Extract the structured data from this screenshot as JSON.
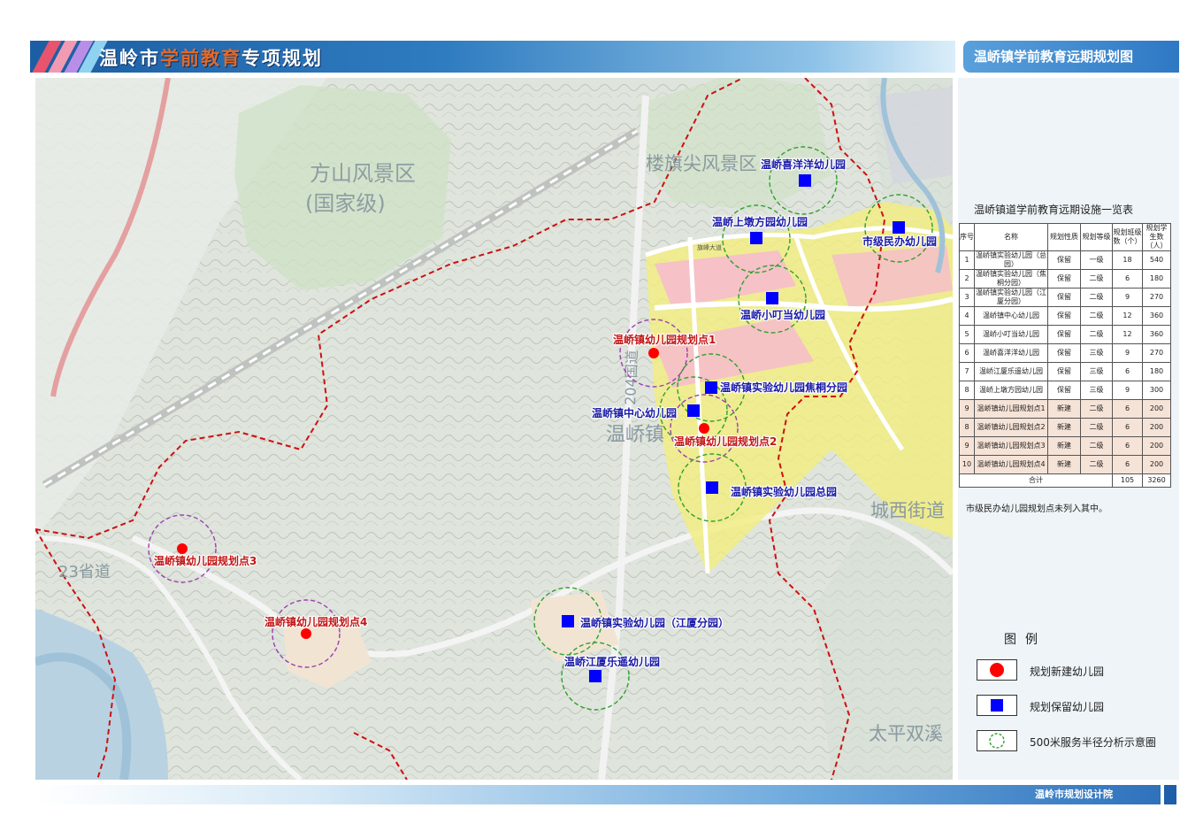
{
  "header": {
    "title_prefix": "温岭市",
    "title_highlight": "学前教育",
    "title_suffix": "专项规划",
    "map_title": "温峤镇学前教育远期规划图"
  },
  "map": {
    "place_labels": {
      "fangshan": "方山风景区",
      "fangshan_level": "(国家级)",
      "louqijian": "楼旗尖风景区",
      "wenqiao": "温峤镇",
      "chengxi": "城西街道",
      "taiping": "太平双溪",
      "road23": "23省道",
      "road204": "204国道",
      "street_east": "旗峰大道"
    },
    "sites": {
      "xiyangyang": "温峤喜洋洋幼儿园",
      "shangdun": "温峤上墩方园幼儿园",
      "shijimin": "市级民办幼儿园",
      "xiaodingdang": "温峤小叮当幼儿园",
      "plan1": "温峤镇幼儿园规划点1",
      "jiaotong": "温峤镇实验幼儿园焦桐分园",
      "zhongxin": "温峤镇中心幼儿园",
      "plan2": "温峤镇幼儿园规划点2",
      "zongyuan": "温峤镇实验幼儿园总园",
      "plan3": "温峤镇幼儿园规划点3",
      "plan4": "温峤镇幼儿园规划点4",
      "jiangxia_branch": "温峤镇实验幼儿园（江厦分园）",
      "jiangxia_leyao": "温峤江厦乐遥幼儿园"
    }
  },
  "table": {
    "title": "温峤镇道学前教育远期设施一览表",
    "headers": [
      "序号",
      "名称",
      "规划性质",
      "规划等级",
      "规划班级数（个）",
      "规划学生数（人）"
    ],
    "rows": [
      [
        "1",
        "温峤镇实验幼儿园（总园）",
        "保留",
        "一级",
        "18",
        "540"
      ],
      [
        "2",
        "温峤镇实验幼儿园（焦桐分园）",
        "保留",
        "二级",
        "6",
        "180"
      ],
      [
        "3",
        "温峤镇实验幼儿园（江厦分园）",
        "保留",
        "二级",
        "9",
        "270"
      ],
      [
        "4",
        "温峤镇中心幼儿园",
        "保留",
        "二级",
        "12",
        "360"
      ],
      [
        "5",
        "温峤小叮当幼儿园",
        "保留",
        "二级",
        "12",
        "360"
      ],
      [
        "6",
        "温峤喜洋洋幼儿园",
        "保留",
        "三级",
        "9",
        "270"
      ],
      [
        "7",
        "温峤江厦乐遥幼儿园",
        "保留",
        "三级",
        "6",
        "180"
      ],
      [
        "8",
        "温峤上墩方园幼儿园",
        "保留",
        "三级",
        "9",
        "300"
      ],
      [
        "9",
        "温峤镇幼儿园规划点1",
        "新建",
        "二级",
        "6",
        "200"
      ],
      [
        "8",
        "温峤镇幼儿园规划点2",
        "新建",
        "二级",
        "6",
        "200"
      ],
      [
        "9",
        "温峤镇幼儿园规划点3",
        "新建",
        "二级",
        "6",
        "200"
      ],
      [
        "10",
        "温峤镇幼儿园规划点4",
        "新建",
        "二级",
        "6",
        "200"
      ]
    ],
    "total": {
      "label": "合计",
      "classes": "105",
      "students": "3260"
    },
    "note": "市级民办幼儿园规划点未列入其中。"
  },
  "legend": {
    "title": "图例",
    "items": [
      {
        "icon": "red-dot-icon",
        "label": "规划新建幼儿园",
        "color": "#ff0000"
      },
      {
        "icon": "blue-square-icon",
        "label": "规划保留幼儿园",
        "color": "#0000ff"
      },
      {
        "icon": "dashed-circle-icon",
        "label": "500米服务半径分析示意圈",
        "color": "#33aa33"
      }
    ]
  },
  "footer": {
    "org": "温岭市规划设计院"
  },
  "colors": {
    "new_site": "#ff0000",
    "keep_site": "#0000ff",
    "service_circle": "#2ea02e",
    "new_circle": "#9b3fb0",
    "boundary": "#cc1111",
    "urban_yellow": "#f3ee7e",
    "urban_pink": "#f6bccd"
  }
}
